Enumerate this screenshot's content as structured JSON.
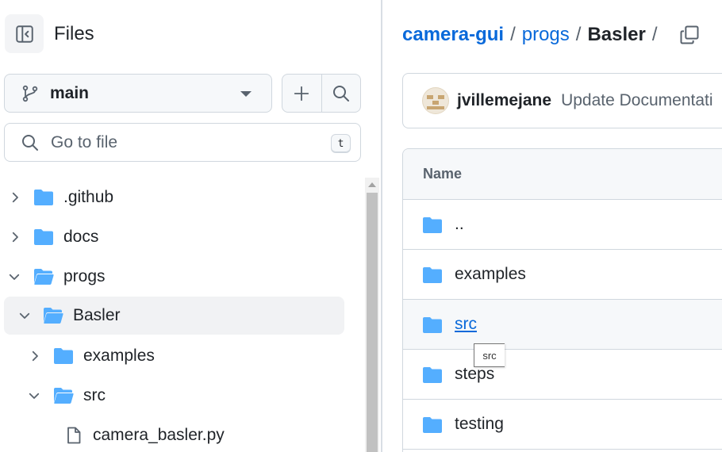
{
  "sidebar": {
    "title": "Files",
    "branch": "main",
    "search": {
      "placeholder": "Go to file",
      "shortcut": "t"
    },
    "tree": [
      {
        "label": ".github",
        "type": "folder",
        "expanded": false
      },
      {
        "label": "docs",
        "type": "folder",
        "expanded": false
      },
      {
        "label": "progs",
        "type": "folder",
        "expanded": true
      },
      {
        "label": "Basler",
        "type": "folder",
        "expanded": true,
        "active": true
      },
      {
        "label": "examples",
        "type": "folder",
        "expanded": false
      },
      {
        "label": "src",
        "type": "folder",
        "expanded": true
      },
      {
        "label": "camera_basler.py",
        "type": "file"
      }
    ]
  },
  "breadcrumb": {
    "repo": "camera-gui",
    "sep": "/",
    "parts": [
      "progs",
      "Basler"
    ]
  },
  "commit": {
    "author": "jvillemejane",
    "message": "Update Documentati"
  },
  "table": {
    "header": "Name",
    "rows": [
      {
        "name": "..",
        "type": "folder"
      },
      {
        "name": "examples",
        "type": "folder"
      },
      {
        "name": "src",
        "type": "folder",
        "hovered": true
      },
      {
        "name": "steps",
        "type": "folder"
      },
      {
        "name": "testing",
        "type": "folder"
      }
    ]
  },
  "tooltip": "src",
  "colors": {
    "folder": "#54aeff",
    "link": "#0969da",
    "border": "#d0d7de",
    "muted": "#59636e"
  }
}
